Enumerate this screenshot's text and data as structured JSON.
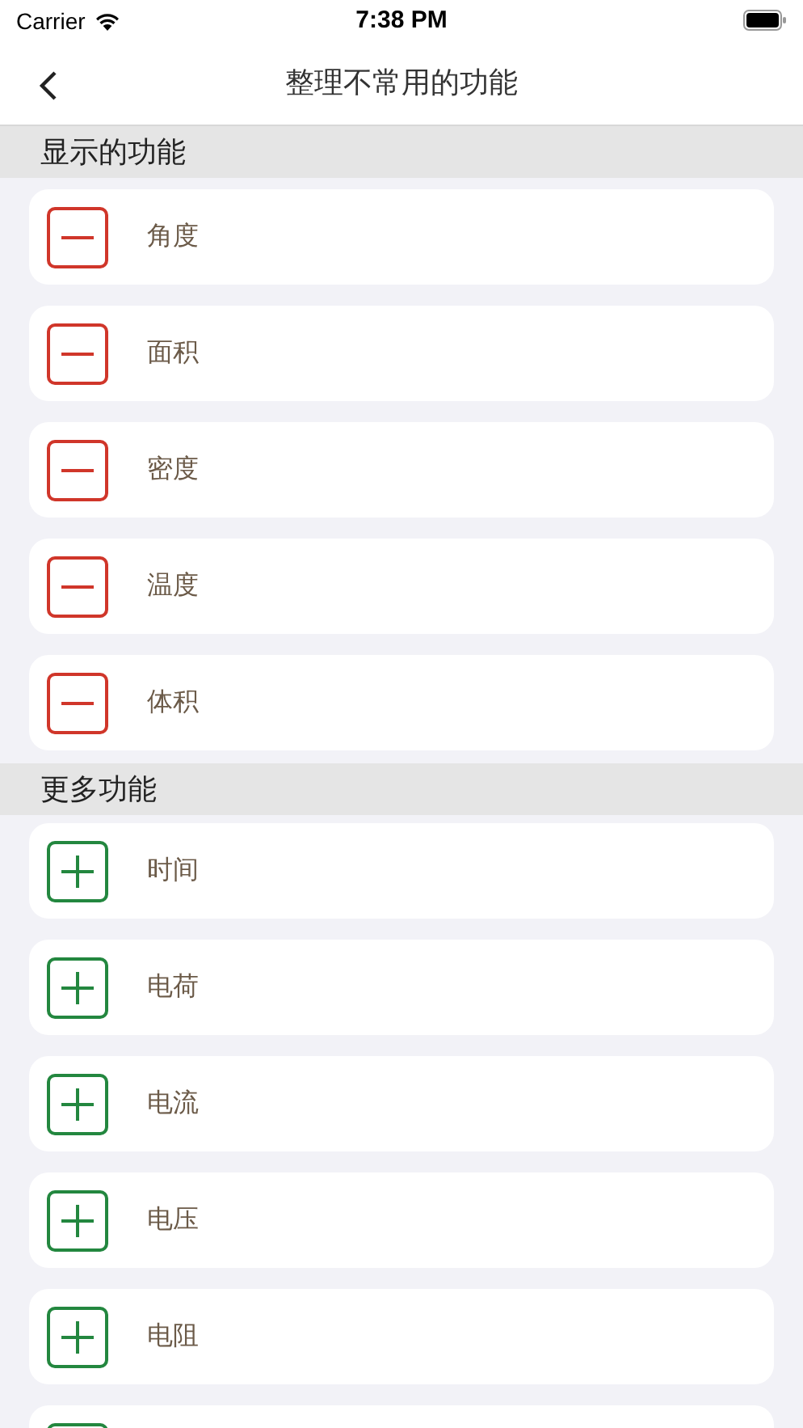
{
  "status_bar": {
    "carrier": "Carrier",
    "time": "7:38 PM"
  },
  "nav": {
    "title": "整理不常用的功能"
  },
  "sections": [
    {
      "title": "显示的功能",
      "items": [
        {
          "label": "角度",
          "kind": "remove"
        },
        {
          "label": "面积",
          "kind": "remove"
        },
        {
          "label": "密度",
          "kind": "remove"
        },
        {
          "label": "温度",
          "kind": "remove"
        },
        {
          "label": "体积",
          "kind": "remove"
        }
      ]
    },
    {
      "title": "更多功能",
      "items": [
        {
          "label": "时间",
          "kind": "add"
        },
        {
          "label": "电荷",
          "kind": "add"
        },
        {
          "label": "电流",
          "kind": "add"
        },
        {
          "label": "电压",
          "kind": "add"
        },
        {
          "label": "电阻",
          "kind": "add"
        },
        {
          "kind": "add"
        }
      ]
    }
  ]
}
